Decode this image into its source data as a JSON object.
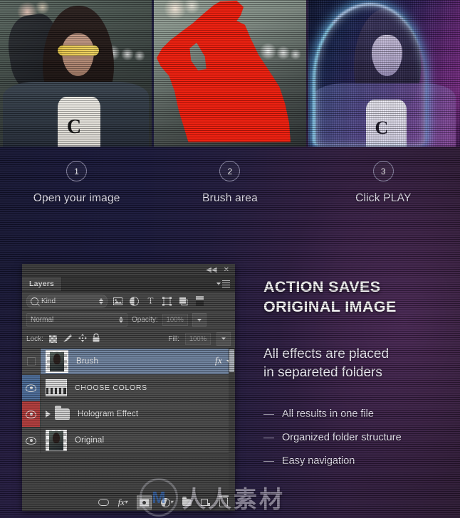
{
  "steps": [
    {
      "number": "1",
      "label": "Open your image",
      "icon": "step-circle"
    },
    {
      "number": "2",
      "label": "Brush area",
      "icon": "step-circle"
    },
    {
      "number": "3",
      "label": "Click PLAY",
      "icon": "step-circle"
    }
  ],
  "previews": [
    {
      "name": "original-photo",
      "caption": "Open your image",
      "letter": "C"
    },
    {
      "name": "brushed-photo",
      "caption": "Brush area",
      "mask_color": "#f01b0a"
    },
    {
      "name": "hologram-photo",
      "caption": "Click PLAY",
      "letter": "C"
    }
  ],
  "panel": {
    "titlebar": {
      "collapse_icon": "collapse-double-arrow-icon",
      "close_icon": "close-icon"
    },
    "tab": "Layers",
    "menu_icon": "panel-menu-icon",
    "filter": {
      "search_icon": "search-icon",
      "kind_label": "Kind",
      "stepper_icon": "stepper-updown-icon",
      "type_filters": [
        {
          "name": "filter-pixel-layers-icon",
          "glyph": "image-icon"
        },
        {
          "name": "filter-adjustment-layers-icon",
          "glyph": "adjustment-icon"
        },
        {
          "name": "filter-type-layers-icon",
          "glyph": "T"
        },
        {
          "name": "filter-shape-layers-icon",
          "glyph": "shape-icon"
        },
        {
          "name": "filter-smart-objects-icon",
          "glyph": "smart-object-icon"
        },
        {
          "name": "filter-toggle-icon",
          "glyph": "toggle-icon"
        }
      ]
    },
    "blend": {
      "mode": "Normal",
      "opacity_label": "Opacity:",
      "opacity_value": "100%"
    },
    "lock": {
      "label": "Lock:",
      "icons": [
        {
          "name": "lock-transparent-pixels-icon"
        },
        {
          "name": "lock-image-pixels-icon"
        },
        {
          "name": "lock-position-icon"
        },
        {
          "name": "lock-all-icon"
        }
      ],
      "fill_label": "Fill:",
      "fill_value": "100%"
    },
    "layers": [
      {
        "name": "Brush",
        "visible": false,
        "selected": true,
        "thumb": "layer-thumbnail",
        "eye_bg": "#4a4a4a",
        "has_fx": true,
        "fx_label": "fx"
      },
      {
        "name": "CHOOSE COLORS",
        "visible": true,
        "selected": false,
        "thumb": "adjustment-thumbnail",
        "eye_bg": "#4a6a96",
        "has_fx": false
      },
      {
        "name": "Hologram Effect",
        "visible": true,
        "selected": false,
        "thumb": "folder-icon",
        "eye_bg": "#b13a3a",
        "expandable": true,
        "has_fx": false
      },
      {
        "name": "Original",
        "visible": true,
        "selected": false,
        "thumb": "layer-thumbnail",
        "eye_bg": "#4a4a4a",
        "has_fx": false
      }
    ],
    "bottom_icons": [
      {
        "name": "link-layers-icon"
      },
      {
        "name": "add-layer-style-icon",
        "glyph": "fx"
      },
      {
        "name": "add-layer-mask-icon"
      },
      {
        "name": "new-adjustment-layer-icon"
      },
      {
        "name": "new-group-icon"
      },
      {
        "name": "new-layer-icon"
      },
      {
        "name": "delete-layer-icon"
      }
    ]
  },
  "copy": {
    "headline_line1": "ACTION SAVES",
    "headline_line2": "ORIGINAL IMAGE",
    "subhead_line1": "All effects are placed",
    "subhead_line2": "in separeted folders",
    "bullets": [
      "All results in one file",
      "Organized folder structure",
      "Easy navigation"
    ]
  },
  "watermark": {
    "logo_text": "M",
    "text": "人人素材"
  },
  "colors": {
    "accent_red": "#b13a3a",
    "accent_blue": "#4a6a96",
    "selection": "#6c7f9c",
    "panel_bg": "#3b3b3b",
    "mask_red": "#f01b0a"
  }
}
